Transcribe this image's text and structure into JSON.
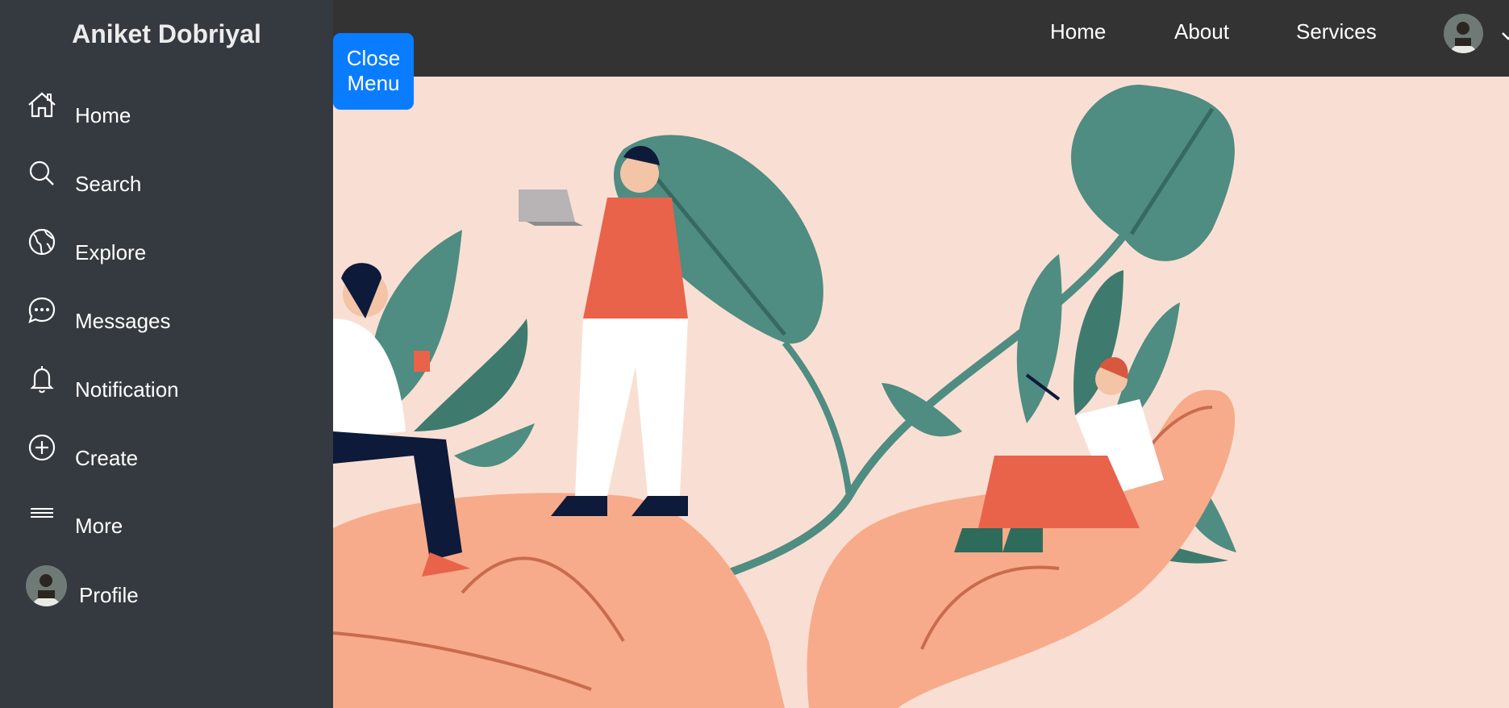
{
  "brand": {
    "name": "Aniket Dobriyal"
  },
  "sidebar": {
    "items": [
      {
        "label": "Home",
        "icon": "home-icon"
      },
      {
        "label": "Search",
        "icon": "search-icon"
      },
      {
        "label": "Explore",
        "icon": "globe-icon"
      },
      {
        "label": "Messages",
        "icon": "chat-icon"
      },
      {
        "label": "Notification",
        "icon": "bell-icon"
      },
      {
        "label": "Create",
        "icon": "plus-circle-icon"
      },
      {
        "label": "More",
        "icon": "menu-lines-icon"
      },
      {
        "label": "Profile",
        "icon": "avatar"
      }
    ]
  },
  "topnav": {
    "links": [
      "Home",
      "About",
      "Services"
    ],
    "dropdown_icon": "chevron-down-icon"
  },
  "close_button": {
    "line1": "Close",
    "line2": "Menu"
  },
  "colors": {
    "sidebar_bg": "#343a40",
    "topbar_bg": "#333333",
    "accent": "#0a7cff",
    "hero_bg": "#f9dfd3",
    "leaf": "#4f8c82",
    "hand": "#f7ab8b",
    "shirt": "#e8634a"
  }
}
